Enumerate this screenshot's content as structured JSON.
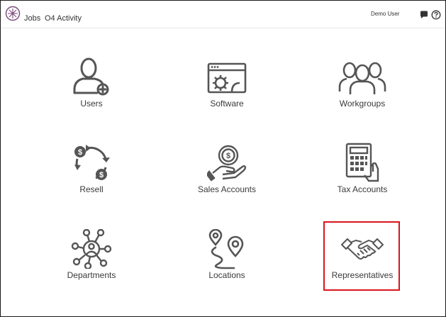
{
  "header": {
    "nav": {
      "jobs": "Jobs",
      "activity": "O4 Activity"
    },
    "user": "Demo User",
    "icons": [
      "logo-icon",
      "chat-icon",
      "help-icon"
    ]
  },
  "tiles": [
    {
      "label": "Users",
      "icon": "user-add-icon"
    },
    {
      "label": "Software",
      "icon": "software-window-icon"
    },
    {
      "label": "Workgroups",
      "icon": "group-icon"
    },
    {
      "label": "Resell",
      "icon": "money-cycle-icon"
    },
    {
      "label": "Sales Accounts",
      "icon": "hand-coin-icon"
    },
    {
      "label": "Tax Accounts",
      "icon": "calculator-icon"
    },
    {
      "label": "Departments",
      "icon": "network-icon"
    },
    {
      "label": "Locations",
      "icon": "map-pins-icon"
    },
    {
      "label": "Representatives",
      "icon": "handshake-icon"
    }
  ],
  "colors": {
    "icon": "#555555",
    "highlight": "#d9161b",
    "logo": "#7a4b7a"
  }
}
